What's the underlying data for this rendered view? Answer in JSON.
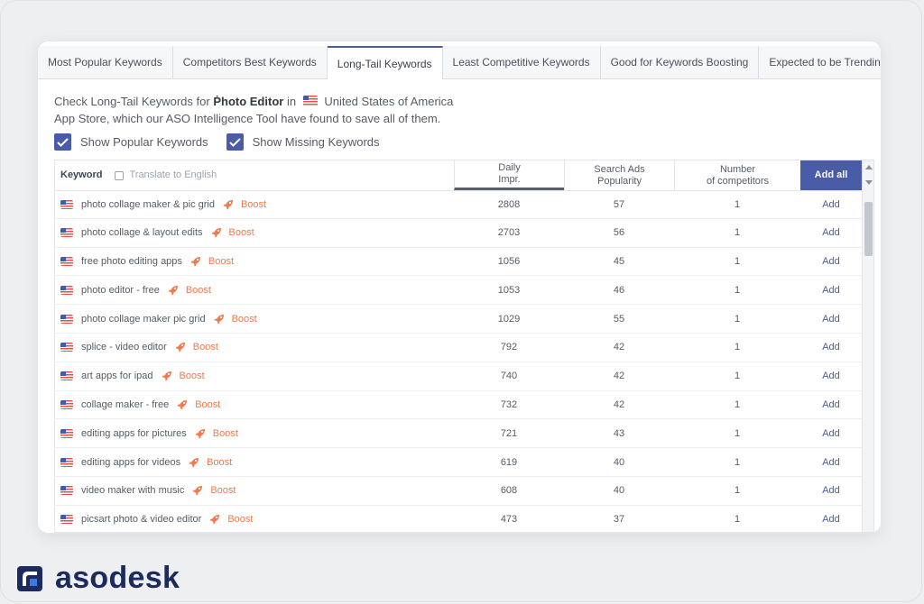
{
  "tabs": [
    {
      "label": "Most Popular Keywords",
      "active": false
    },
    {
      "label": "Competitors Best Keywords",
      "active": false
    },
    {
      "label": "Long-Tail Keywords",
      "active": true
    },
    {
      "label": "Least Competitive Keywords",
      "active": false
    },
    {
      "label": "Good for Keywords Boosting",
      "active": false
    },
    {
      "label": "Expected to be Trending",
      "active": false
    }
  ],
  "description": {
    "prefix": "Check Long-Tail Keywords for",
    "app_name": "Ṗhoto Editor",
    "in": "in",
    "country": "United States of America",
    "line2": "App Store, which our ASO Intelligence Tool have found to save all of them."
  },
  "options": {
    "show_popular": "Show Popular Keywords",
    "show_missing": "Show Missing Keywords"
  },
  "table": {
    "keyword_header": "Keyword",
    "translate_label": "Translate to English",
    "daily_header_line1": "Daily",
    "daily_header_line2": "Impr.",
    "popularity_header_line1": "Search Ads",
    "popularity_header_line2": "Popularity",
    "competitors_header_line1": "Number",
    "competitors_header_line2": "of competitors",
    "add_all": "Add all",
    "boost_label": "Boost",
    "add_label": "Add",
    "rows": [
      {
        "keyword": "photo collage maker & pic grid",
        "daily": "2808",
        "popularity": "57",
        "competitors": "1"
      },
      {
        "keyword": "photo collage & layout edits",
        "daily": "2703",
        "popularity": "56",
        "competitors": "1"
      },
      {
        "keyword": "free photo editing apps",
        "daily": "1056",
        "popularity": "45",
        "competitors": "1"
      },
      {
        "keyword": "photo editor - free",
        "daily": "1053",
        "popularity": "46",
        "competitors": "1"
      },
      {
        "keyword": "photo collage maker pic grid",
        "daily": "1029",
        "popularity": "55",
        "competitors": "1"
      },
      {
        "keyword": "splice - video editor",
        "daily": "792",
        "popularity": "42",
        "competitors": "1"
      },
      {
        "keyword": "art apps for ipad",
        "daily": "740",
        "popularity": "42",
        "competitors": "1"
      },
      {
        "keyword": "collage maker - free",
        "daily": "732",
        "popularity": "42",
        "competitors": "1"
      },
      {
        "keyword": "editing apps for pictures",
        "daily": "721",
        "popularity": "43",
        "competitors": "1"
      },
      {
        "keyword": "editing apps for videos",
        "daily": "619",
        "popularity": "40",
        "competitors": "1"
      },
      {
        "keyword": "video maker with music",
        "daily": "608",
        "popularity": "40",
        "competitors": "1"
      },
      {
        "keyword": "picsart photo & video editor",
        "daily": "473",
        "popularity": "37",
        "competitors": "1"
      }
    ]
  },
  "branding": {
    "logo_text": "asodesk"
  },
  "colors": {
    "accent": "#4a5ba8",
    "boost": "#f07a4e",
    "logo": "#1c2a5e"
  }
}
